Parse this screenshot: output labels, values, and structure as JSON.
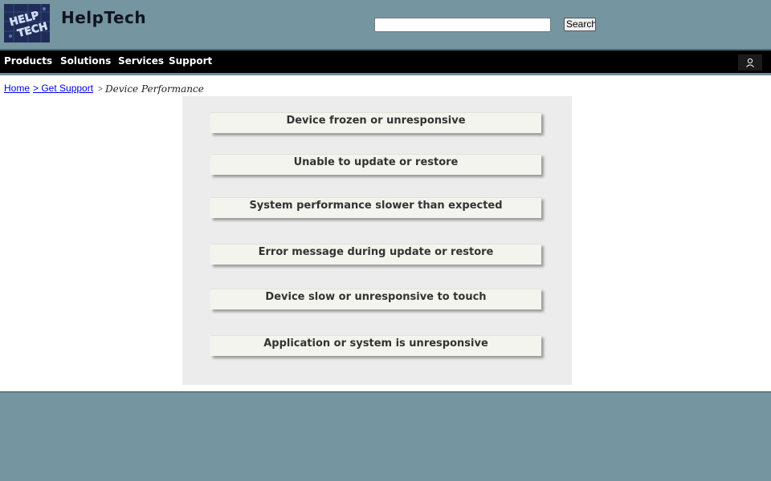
{
  "header": {
    "brand": "HelpTech",
    "logo_text": "HELP TECH",
    "search": {
      "value": "",
      "placeholder": "",
      "button_label": "Search"
    }
  },
  "nav": {
    "items": [
      {
        "label": "Products"
      },
      {
        "label": "Solutions"
      },
      {
        "label": "Services"
      },
      {
        "label": "Support"
      }
    ],
    "user_icon": "person-icon"
  },
  "breadcrumb": {
    "home": "Home",
    "get_support": "> Get Support",
    "separator": ">",
    "current": "Device Performance"
  },
  "issues": [
    {
      "label": "Device frozen or unresponsive"
    },
    {
      "label": "Unable to update or restore"
    },
    {
      "label": "System performance slower than expected"
    },
    {
      "label": "Error message during update or restore"
    },
    {
      "label": "Device slow or unresponsive to touch"
    },
    {
      "label": "Application or system is unresponsive"
    }
  ],
  "colors": {
    "header_bg": "#7595a0",
    "nav_bg": "#000000",
    "panel_bg": "#ececec",
    "link": "#0000ee"
  }
}
